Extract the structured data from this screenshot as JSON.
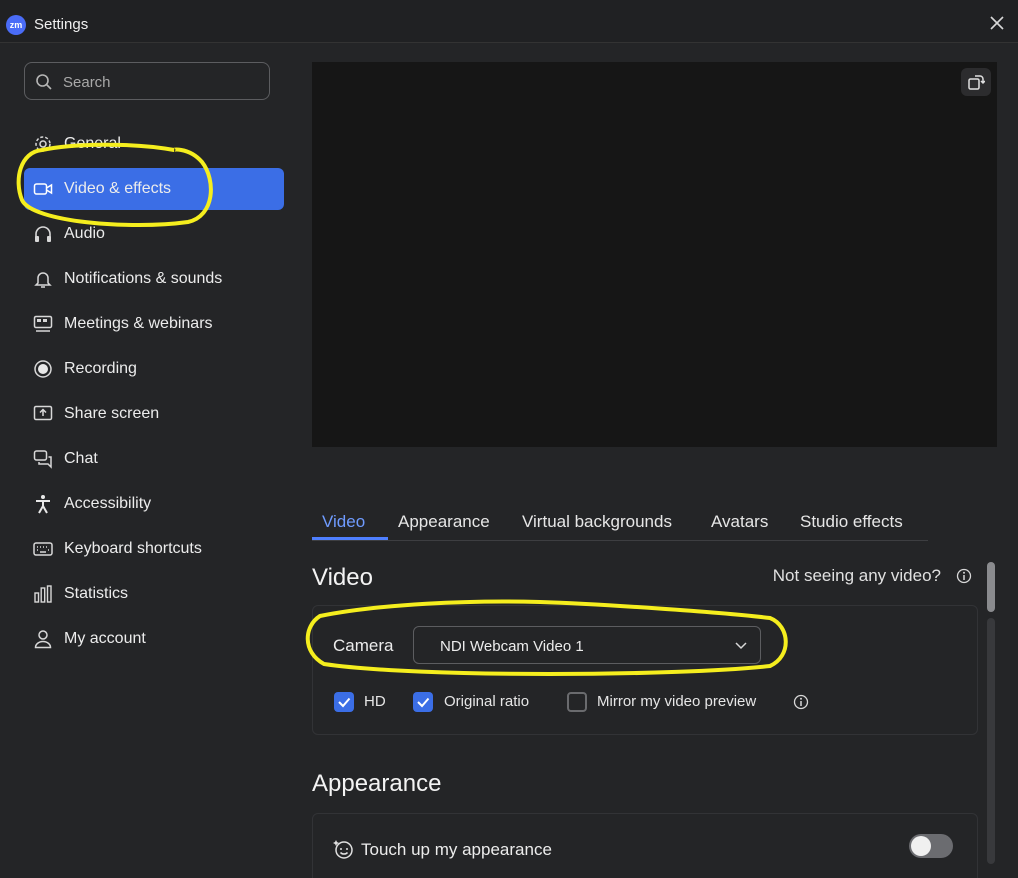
{
  "window": {
    "title": "Settings",
    "logo_text": "zm"
  },
  "search": {
    "placeholder": "Search"
  },
  "sidebar": {
    "items": [
      {
        "label": "General",
        "icon": "gear-icon"
      },
      {
        "label": "Video & effects",
        "icon": "video-camera-icon",
        "active": true
      },
      {
        "label": "Audio",
        "icon": "headphones-icon"
      },
      {
        "label": "Notifications & sounds",
        "icon": "bell-icon"
      },
      {
        "label": "Meetings & webinars",
        "icon": "meetings-icon"
      },
      {
        "label": "Recording",
        "icon": "record-icon"
      },
      {
        "label": "Share screen",
        "icon": "share-screen-icon"
      },
      {
        "label": "Chat",
        "icon": "chat-icon"
      },
      {
        "label": "Accessibility",
        "icon": "accessibility-icon"
      },
      {
        "label": "Keyboard shortcuts",
        "icon": "keyboard-icon"
      },
      {
        "label": "Statistics",
        "icon": "statistics-icon"
      },
      {
        "label": "My account",
        "icon": "user-icon"
      }
    ]
  },
  "tabs": [
    {
      "label": "Video",
      "active": true
    },
    {
      "label": "Appearance"
    },
    {
      "label": "Virtual backgrounds"
    },
    {
      "label": "Avatars"
    },
    {
      "label": "Studio effects"
    }
  ],
  "video_section": {
    "title": "Video",
    "help_text": "Not seeing any video?",
    "camera_label": "Camera",
    "camera_value": "NDI Webcam Video 1",
    "options": [
      {
        "label": "HD",
        "checked": true
      },
      {
        "label": "Original ratio",
        "checked": true
      },
      {
        "label": "Mirror my video preview",
        "checked": false
      }
    ]
  },
  "appearance_section": {
    "title": "Appearance",
    "touch_up_label": "Touch up my appearance",
    "touch_up_enabled": false
  },
  "colors": {
    "accent": "#3b6ee6",
    "annotation": "#f5ee1e",
    "background": "#242527"
  }
}
